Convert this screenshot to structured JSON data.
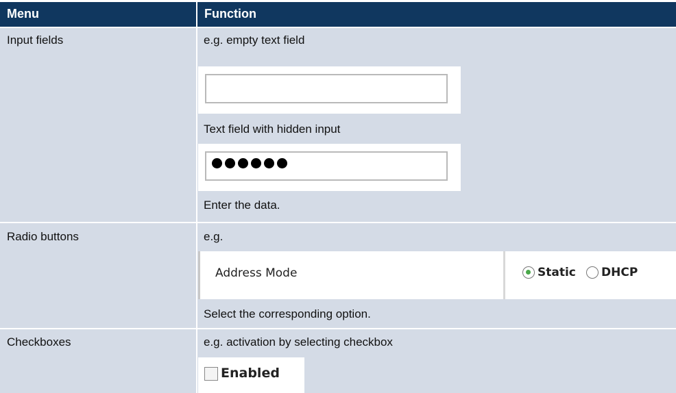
{
  "top_strip_text": "Menu Function — (cropped line above table)",
  "headers": {
    "menu": "Menu",
    "function": "Function"
  },
  "rows": {
    "input_fields": {
      "menu": "Input fields",
      "intro": "e.g. empty text field",
      "hidden_caption": "Text field with hidden input",
      "hidden_value": "••••••",
      "footer": "Enter the data."
    },
    "radio_buttons": {
      "menu": "Radio buttons",
      "intro": "e.g.",
      "field_label": "Address Mode",
      "options": [
        "Static",
        "DHCP"
      ],
      "selected": "Static",
      "footer": "Select the corresponding option."
    },
    "checkboxes": {
      "menu": "Checkboxes",
      "intro": "e.g. activation by selecting checkbox",
      "checkbox_label": "Enabled",
      "checked": false
    }
  },
  "colors": {
    "header_bg": "#10375f",
    "cell_bg": "#d4dbe6",
    "radio_selected": "#4aa84a"
  }
}
